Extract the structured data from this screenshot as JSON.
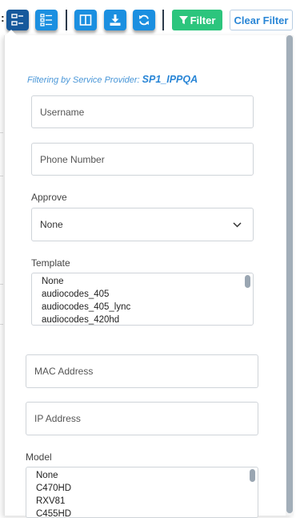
{
  "toolbar": {
    "colon": ":",
    "buttons": [
      {
        "name": "tree-view-icon"
      },
      {
        "name": "list-view-icon"
      },
      {
        "name": "columns-icon"
      },
      {
        "name": "download-icon"
      },
      {
        "name": "refresh-icon"
      }
    ],
    "filter_label": "Filter",
    "clear_filter_label": "Clear Filter",
    "colors": {
      "primary": "#1b8fe0",
      "primary_dark": "#16599c",
      "filter": "#2cc57d",
      "link": "#2a86d6"
    }
  },
  "panel": {
    "filtering_prefix": "Filtering by Service Provider:",
    "service_provider": "SP1_IPPQA",
    "username": {
      "placeholder": "Username"
    },
    "phone_number": {
      "placeholder": "Phone Number"
    },
    "approve": {
      "label": "Approve",
      "selected": "None"
    },
    "template": {
      "label": "Template",
      "options": [
        "None",
        "audiocodes_405",
        "audiocodes_405_lync",
        "audiocodes_420hd"
      ]
    },
    "mac_address": {
      "placeholder": "MAC Address"
    },
    "ip_address": {
      "placeholder": "IP Address"
    },
    "model": {
      "label": "Model",
      "options": [
        "None",
        "C470HD",
        "RXV81",
        "C455HD"
      ]
    }
  }
}
